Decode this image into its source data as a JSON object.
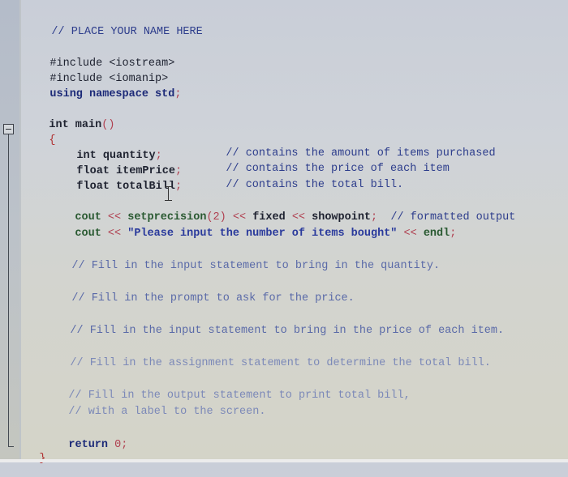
{
  "editor": {
    "header_comment": "// PLACE YOUR NAME HERE",
    "include1": "#include <iostream>",
    "include2": "#include <iomanip>",
    "using_kw": "using namespace std",
    "using_semi": ";",
    "main_sig": "int main",
    "main_parens": "()",
    "open_brace": "{",
    "decls": [
      {
        "type": "int",
        "name": "quantity",
        "semi": ";",
        "comment": "// contains the amount of items purchased"
      },
      {
        "type": "float",
        "name": "itemPrice",
        "semi": ";",
        "comment": "// contains the price of each item"
      },
      {
        "type": "float",
        "name": "totalBill",
        "semi": ";",
        "comment": "// contains the total bill."
      }
    ],
    "cout1": {
      "cout": "cout",
      "op1": "<<",
      "fn": "setprecision",
      "arg": "(2)",
      "op2": "<<",
      "fixed": "fixed",
      "op3": "<<",
      "showpoint": "showpoint",
      "semi": ";",
      "comment": "// formatted output"
    },
    "cout2": {
      "cout": "cout",
      "op1": "<<",
      "string": "\"Please input the number of items bought\"",
      "op2": "<<",
      "endl": "endl",
      "semi": ";"
    },
    "todo_comments": [
      "// Fill in the input statement to bring in the quantity.",
      "// Fill in the prompt to ask for the price.",
      "// Fill in the input statement to bring in the price of each item.",
      "// Fill in the assignment statement to determine the total bill.",
      "// Fill in the output statement to print total bill,",
      "// with a label to the screen."
    ],
    "return_kw": "return",
    "return_val": "0",
    "return_semi": ";",
    "close_brace": "}"
  }
}
